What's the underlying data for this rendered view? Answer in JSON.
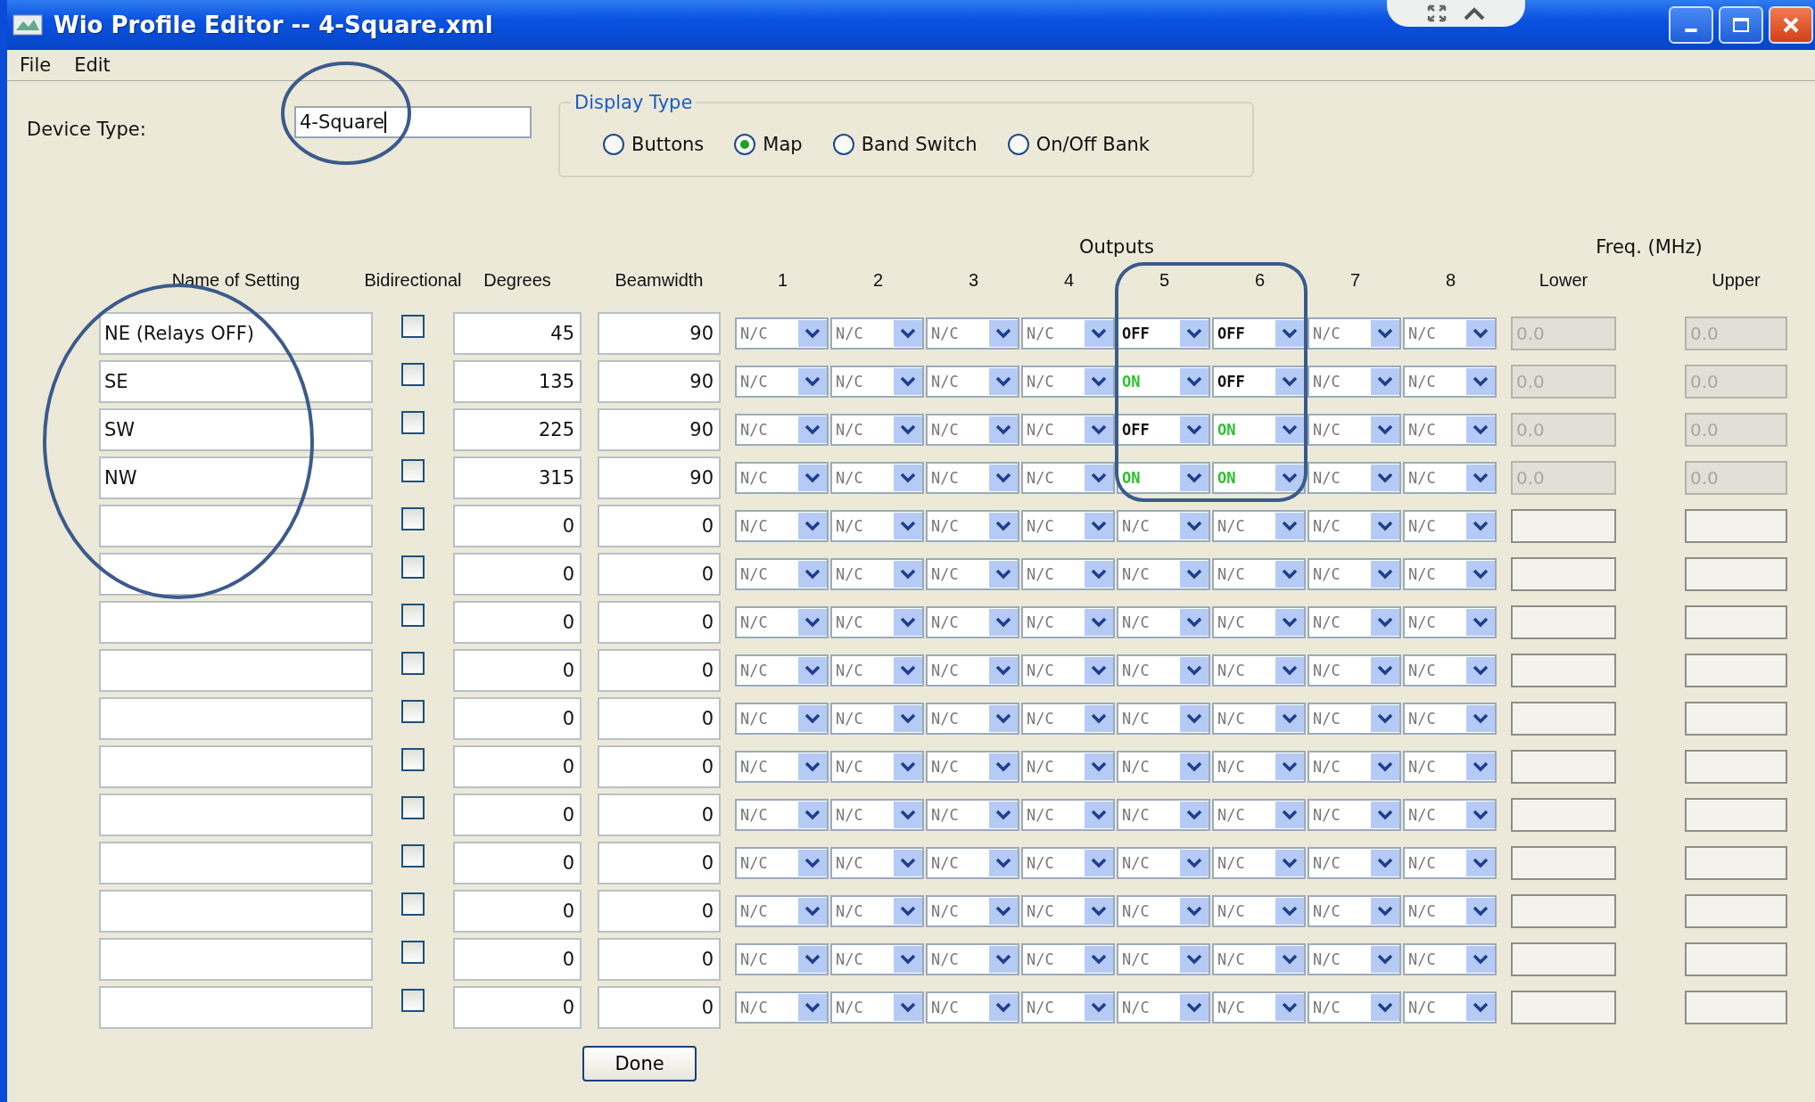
{
  "window": {
    "title": "Wio Profile Editor -- 4-Square.xml"
  },
  "menu": [
    "File",
    "Edit"
  ],
  "device_type": {
    "label": "Device Type:",
    "value": "4-Square"
  },
  "display_type": {
    "title": "Display Type",
    "options": [
      {
        "label": "Buttons",
        "selected": false
      },
      {
        "label": "Map",
        "selected": true
      },
      {
        "label": "Band Switch",
        "selected": false
      },
      {
        "label": "On/Off Bank",
        "selected": false
      }
    ]
  },
  "group_headers": {
    "outputs": "Outputs",
    "freq": "Freq. (MHz)"
  },
  "columns": {
    "name": "Name of Setting",
    "bidirectional": "Bidirectional",
    "degrees": "Degrees",
    "beamwidth": "Beamwidth",
    "outputs": [
      "1",
      "2",
      "3",
      "4",
      "5",
      "6",
      "7",
      "8"
    ],
    "lower": "Lower",
    "upper": "Upper"
  },
  "rows": [
    {
      "name": "NE (Relays OFF)",
      "bidirectional": false,
      "degrees": "45",
      "beamwidth": "90",
      "outputs": [
        {
          "value": "N/C",
          "kind": "nc"
        },
        {
          "value": "N/C",
          "kind": "nc"
        },
        {
          "value": "N/C",
          "kind": "nc"
        },
        {
          "value": "N/C",
          "kind": "nc"
        },
        {
          "value": "OFF",
          "kind": "off"
        },
        {
          "value": "OFF",
          "kind": "off"
        },
        {
          "value": "N/C",
          "kind": "nc"
        },
        {
          "value": "N/C",
          "kind": "nc"
        }
      ],
      "lower": "0.0",
      "upper": "0.0",
      "freq_disabled": true
    },
    {
      "name": "SE",
      "bidirectional": false,
      "degrees": "135",
      "beamwidth": "90",
      "outputs": [
        {
          "value": "N/C",
          "kind": "nc"
        },
        {
          "value": "N/C",
          "kind": "nc"
        },
        {
          "value": "N/C",
          "kind": "nc"
        },
        {
          "value": "N/C",
          "kind": "nc"
        },
        {
          "value": "ON",
          "kind": "on"
        },
        {
          "value": "OFF",
          "kind": "off"
        },
        {
          "value": "N/C",
          "kind": "nc"
        },
        {
          "value": "N/C",
          "kind": "nc"
        }
      ],
      "lower": "0.0",
      "upper": "0.0",
      "freq_disabled": true
    },
    {
      "name": "SW",
      "bidirectional": false,
      "degrees": "225",
      "beamwidth": "90",
      "outputs": [
        {
          "value": "N/C",
          "kind": "nc"
        },
        {
          "value": "N/C",
          "kind": "nc"
        },
        {
          "value": "N/C",
          "kind": "nc"
        },
        {
          "value": "N/C",
          "kind": "nc"
        },
        {
          "value": "OFF",
          "kind": "off"
        },
        {
          "value": "ON",
          "kind": "on"
        },
        {
          "value": "N/C",
          "kind": "nc"
        },
        {
          "value": "N/C",
          "kind": "nc"
        }
      ],
      "lower": "0.0",
      "upper": "0.0",
      "freq_disabled": true
    },
    {
      "name": "NW",
      "bidirectional": false,
      "degrees": "315",
      "beamwidth": "90",
      "outputs": [
        {
          "value": "N/C",
          "kind": "nc"
        },
        {
          "value": "N/C",
          "kind": "nc"
        },
        {
          "value": "N/C",
          "kind": "nc"
        },
        {
          "value": "N/C",
          "kind": "nc"
        },
        {
          "value": "ON",
          "kind": "on"
        },
        {
          "value": "ON",
          "kind": "on"
        },
        {
          "value": "N/C",
          "kind": "nc"
        },
        {
          "value": "N/C",
          "kind": "nc"
        }
      ],
      "lower": "0.0",
      "upper": "0.0",
      "freq_disabled": true
    },
    {
      "bidirectional": false,
      "degrees": "0",
      "beamwidth": "0",
      "outputs": [
        {
          "value": "N/C",
          "kind": "nc"
        },
        {
          "value": "N/C",
          "kind": "nc"
        },
        {
          "value": "N/C",
          "kind": "nc"
        },
        {
          "value": "N/C",
          "kind": "nc"
        },
        {
          "value": "N/C",
          "kind": "nc"
        },
        {
          "value": "N/C",
          "kind": "nc"
        },
        {
          "value": "N/C",
          "kind": "nc"
        },
        {
          "value": "N/C",
          "kind": "nc"
        }
      ],
      "freq_disabled": false
    },
    {
      "bidirectional": false,
      "degrees": "0",
      "beamwidth": "0",
      "outputs": [
        {
          "value": "N/C",
          "kind": "nc"
        },
        {
          "value": "N/C",
          "kind": "nc"
        },
        {
          "value": "N/C",
          "kind": "nc"
        },
        {
          "value": "N/C",
          "kind": "nc"
        },
        {
          "value": "N/C",
          "kind": "nc"
        },
        {
          "value": "N/C",
          "kind": "nc"
        },
        {
          "value": "N/C",
          "kind": "nc"
        },
        {
          "value": "N/C",
          "kind": "nc"
        }
      ],
      "freq_disabled": false
    },
    {
      "bidirectional": false,
      "degrees": "0",
      "beamwidth": "0",
      "outputs": [
        {
          "value": "N/C",
          "kind": "nc"
        },
        {
          "value": "N/C",
          "kind": "nc"
        },
        {
          "value": "N/C",
          "kind": "nc"
        },
        {
          "value": "N/C",
          "kind": "nc"
        },
        {
          "value": "N/C",
          "kind": "nc"
        },
        {
          "value": "N/C",
          "kind": "nc"
        },
        {
          "value": "N/C",
          "kind": "nc"
        },
        {
          "value": "N/C",
          "kind": "nc"
        }
      ],
      "freq_disabled": false
    },
    {
      "bidirectional": false,
      "degrees": "0",
      "beamwidth": "0",
      "outputs": [
        {
          "value": "N/C",
          "kind": "nc"
        },
        {
          "value": "N/C",
          "kind": "nc"
        },
        {
          "value": "N/C",
          "kind": "nc"
        },
        {
          "value": "N/C",
          "kind": "nc"
        },
        {
          "value": "N/C",
          "kind": "nc"
        },
        {
          "value": "N/C",
          "kind": "nc"
        },
        {
          "value": "N/C",
          "kind": "nc"
        },
        {
          "value": "N/C",
          "kind": "nc"
        }
      ],
      "freq_disabled": false
    },
    {
      "bidirectional": false,
      "degrees": "0",
      "beamwidth": "0",
      "outputs": [
        {
          "value": "N/C",
          "kind": "nc"
        },
        {
          "value": "N/C",
          "kind": "nc"
        },
        {
          "value": "N/C",
          "kind": "nc"
        },
        {
          "value": "N/C",
          "kind": "nc"
        },
        {
          "value": "N/C",
          "kind": "nc"
        },
        {
          "value": "N/C",
          "kind": "nc"
        },
        {
          "value": "N/C",
          "kind": "nc"
        },
        {
          "value": "N/C",
          "kind": "nc"
        }
      ],
      "freq_disabled": false
    },
    {
      "bidirectional": false,
      "degrees": "0",
      "beamwidth": "0",
      "outputs": [
        {
          "value": "N/C",
          "kind": "nc"
        },
        {
          "value": "N/C",
          "kind": "nc"
        },
        {
          "value": "N/C",
          "kind": "nc"
        },
        {
          "value": "N/C",
          "kind": "nc"
        },
        {
          "value": "N/C",
          "kind": "nc"
        },
        {
          "value": "N/C",
          "kind": "nc"
        },
        {
          "value": "N/C",
          "kind": "nc"
        },
        {
          "value": "N/C",
          "kind": "nc"
        }
      ],
      "freq_disabled": false
    },
    {
      "bidirectional": false,
      "degrees": "0",
      "beamwidth": "0",
      "outputs": [
        {
          "value": "N/C",
          "kind": "nc"
        },
        {
          "value": "N/C",
          "kind": "nc"
        },
        {
          "value": "N/C",
          "kind": "nc"
        },
        {
          "value": "N/C",
          "kind": "nc"
        },
        {
          "value": "N/C",
          "kind": "nc"
        },
        {
          "value": "N/C",
          "kind": "nc"
        },
        {
          "value": "N/C",
          "kind": "nc"
        },
        {
          "value": "N/C",
          "kind": "nc"
        }
      ],
      "freq_disabled": false
    },
    {
      "bidirectional": false,
      "degrees": "0",
      "beamwidth": "0",
      "outputs": [
        {
          "value": "N/C",
          "kind": "nc"
        },
        {
          "value": "N/C",
          "kind": "nc"
        },
        {
          "value": "N/C",
          "kind": "nc"
        },
        {
          "value": "N/C",
          "kind": "nc"
        },
        {
          "value": "N/C",
          "kind": "nc"
        },
        {
          "value": "N/C",
          "kind": "nc"
        },
        {
          "value": "N/C",
          "kind": "nc"
        },
        {
          "value": "N/C",
          "kind": "nc"
        }
      ],
      "freq_disabled": false
    },
    {
      "bidirectional": false,
      "degrees": "0",
      "beamwidth": "0",
      "outputs": [
        {
          "value": "N/C",
          "kind": "nc"
        },
        {
          "value": "N/C",
          "kind": "nc"
        },
        {
          "value": "N/C",
          "kind": "nc"
        },
        {
          "value": "N/C",
          "kind": "nc"
        },
        {
          "value": "N/C",
          "kind": "nc"
        },
        {
          "value": "N/C",
          "kind": "nc"
        },
        {
          "value": "N/C",
          "kind": "nc"
        },
        {
          "value": "N/C",
          "kind": "nc"
        }
      ],
      "freq_disabled": false
    },
    {
      "bidirectional": false,
      "degrees": "0",
      "beamwidth": "0",
      "outputs": [
        {
          "value": "N/C",
          "kind": "nc"
        },
        {
          "value": "N/C",
          "kind": "nc"
        },
        {
          "value": "N/C",
          "kind": "nc"
        },
        {
          "value": "N/C",
          "kind": "nc"
        },
        {
          "value": "N/C",
          "kind": "nc"
        },
        {
          "value": "N/C",
          "kind": "nc"
        },
        {
          "value": "N/C",
          "kind": "nc"
        },
        {
          "value": "N/C",
          "kind": "nc"
        }
      ],
      "freq_disabled": false
    },
    {
      "bidirectional": false,
      "degrees": "0",
      "beamwidth": "0",
      "outputs": [
        {
          "value": "N/C",
          "kind": "nc"
        },
        {
          "value": "N/C",
          "kind": "nc"
        },
        {
          "value": "N/C",
          "kind": "nc"
        },
        {
          "value": "N/C",
          "kind": "nc"
        },
        {
          "value": "N/C",
          "kind": "nc"
        },
        {
          "value": "N/C",
          "kind": "nc"
        },
        {
          "value": "N/C",
          "kind": "nc"
        },
        {
          "value": "N/C",
          "kind": "nc"
        }
      ],
      "freq_disabled": false
    }
  ],
  "buttons": [
    "Done"
  ]
}
